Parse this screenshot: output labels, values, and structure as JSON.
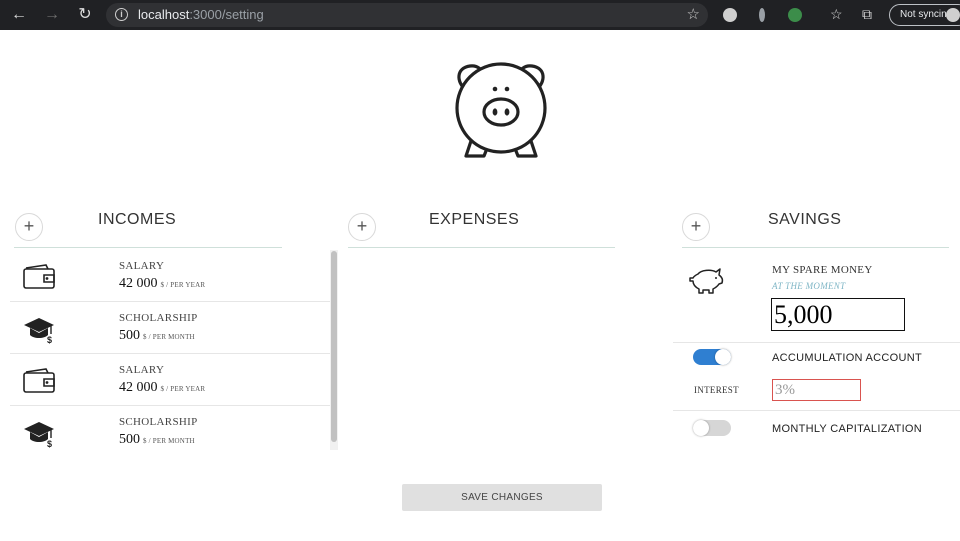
{
  "browser": {
    "url_host": "localhost",
    "url_path": ":3000/setting",
    "sync_label": "Not syncing"
  },
  "incomes": {
    "title": "INCOMES",
    "add_symbol": "+",
    "items": [
      {
        "icon": "wallet-icon",
        "name": "SALARY",
        "amount": "42 000",
        "unit": "$ / PER YEAR"
      },
      {
        "icon": "graduation-cap-icon",
        "name": "SCHOLARSHIP",
        "amount": "500",
        "unit": "$ / PER MONTH"
      },
      {
        "icon": "wallet-icon",
        "name": "SALARY",
        "amount": "42 000",
        "unit": "$ / PER YEAR"
      },
      {
        "icon": "graduation-cap-icon",
        "name": "SCHOLARSHIP",
        "amount": "500",
        "unit": "$ / PER MONTH"
      }
    ]
  },
  "expenses": {
    "title": "EXPENSES",
    "add_symbol": "+"
  },
  "savings": {
    "title": "SAVINGS",
    "add_symbol": "+",
    "spare_label": "MY SPARE MONEY",
    "spare_sub": "AT THE MOMENT",
    "spare_value": "5,000",
    "accumulation_label": "ACCUMULATION ACCOUNT",
    "accumulation_on": true,
    "interest_label": "INTEREST",
    "interest_value": "3%",
    "capitalization_label": "MONTHLY CAPITALIZATION",
    "capitalization_on": false
  },
  "save_label": "SAVE CHANGES",
  "colors": {
    "toggle_on": "#2f7fd1",
    "toggle_off": "#d6d6d6",
    "accent_sub": "#7fb6c6",
    "error_border": "#d9534f"
  }
}
